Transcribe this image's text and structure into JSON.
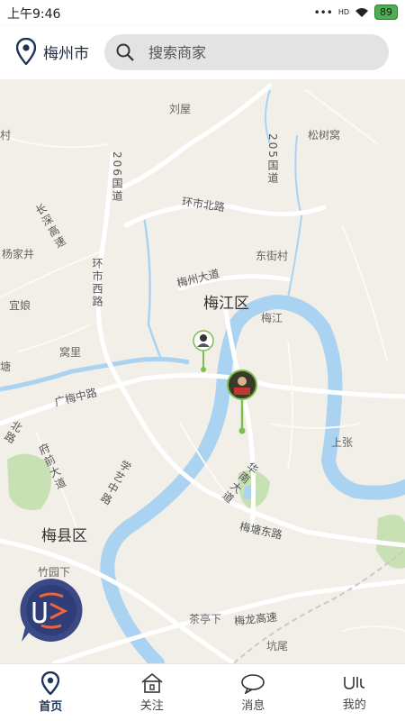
{
  "status": {
    "time": "上午9:46",
    "battery": "89",
    "signal": "HD"
  },
  "header": {
    "city": "梅州市",
    "search_placeholder": "搜索商家"
  },
  "map": {
    "labels": {
      "liuwu": "刘屋",
      "songshuwo": "松树窝",
      "g206": "206国道",
      "g205": "205国道",
      "huanshi_north": "环市北路",
      "dongjie": "东街村",
      "changshen": "长深高速",
      "yangjiajing": "杨家井",
      "meizhou_ave": "梅州大道",
      "meijiang_district": "梅江区",
      "meijiang_river": "梅江",
      "huanshi_west": "环市西路",
      "yiniang": "宜娘",
      "woli": "窝里",
      "tang": "塘",
      "guangmei": "广梅中路",
      "shangzhang": "上张",
      "beilu": "北路",
      "fuqian": "府前大道",
      "xueyi": "学艺中路",
      "huanan": "华南大道",
      "meitang": "梅塘东路",
      "meixian_district": "梅县区",
      "zhuyuanxia": "竹园下",
      "chatingxia": "茶亭下",
      "meilong": "梅龙高速",
      "kengwei": "坑尾",
      "cun": "村"
    }
  },
  "tabs": [
    {
      "label": "首页"
    },
    {
      "label": "关注"
    },
    {
      "label": "消息"
    },
    {
      "label": "我的"
    }
  ],
  "colors": {
    "primary": "#1d3557",
    "water": "#a9d3f0",
    "park": "#b9dba5",
    "marker": "#7cbf4e"
  }
}
